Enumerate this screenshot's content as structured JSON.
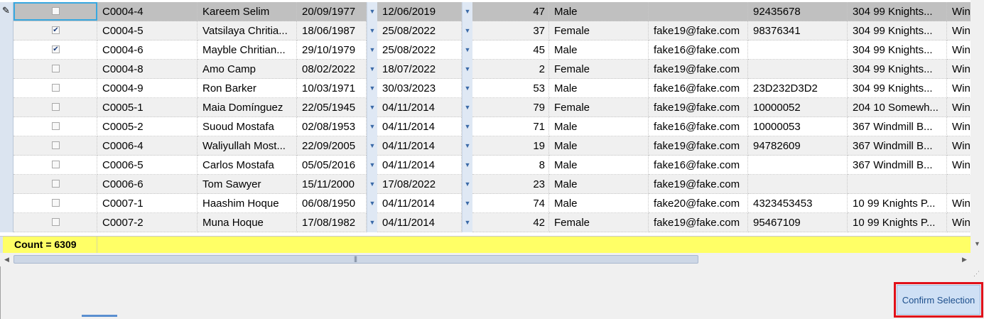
{
  "grid": {
    "rows": [
      {
        "selected": false,
        "code": "C0004-4",
        "name": "Kareem Selim",
        "dob": "20/09/1977",
        "date2": "12/06/2019",
        "age": "47",
        "gender": "Male",
        "email": "",
        "phone": "92435678",
        "address": "304 99 Knights...",
        "city": "Win"
      },
      {
        "selected": true,
        "code": "C0004-5",
        "name": "Vatsilaya Chritia...",
        "dob": "18/06/1987",
        "date2": "25/08/2022",
        "age": "37",
        "gender": "Female",
        "email": "fake19@fake.com",
        "phone": "98376341",
        "address": "304 99 Knights...",
        "city": "Win"
      },
      {
        "selected": true,
        "code": "C0004-6",
        "name": "Mayble Chritian...",
        "dob": "29/10/1979",
        "date2": "25/08/2022",
        "age": "45",
        "gender": "Male",
        "email": "fake16@fake.com",
        "phone": "",
        "address": "304 99 Knights...",
        "city": "Win"
      },
      {
        "selected": false,
        "code": "C0004-8",
        "name": "Amo Camp",
        "dob": "08/02/2022",
        "date2": "18/07/2022",
        "age": "2",
        "gender": "Female",
        "email": "fake19@fake.com",
        "phone": "",
        "address": "304 99 Knights...",
        "city": "Win"
      },
      {
        "selected": false,
        "code": "C0004-9",
        "name": "Ron Barker",
        "dob": "10/03/1971",
        "date2": "30/03/2023",
        "age": "53",
        "gender": "Male",
        "email": "fake16@fake.com",
        "phone": "23D232D3D2",
        "address": "304 99 Knights...",
        "city": "Win"
      },
      {
        "selected": false,
        "code": "C0005-1",
        "name": "Maia Domínguez",
        "dob": "22/05/1945",
        "date2": "04/11/2014",
        "age": "79",
        "gender": "Female",
        "email": "fake19@fake.com",
        "phone": "10000052",
        "address": "204 10 Somewh...",
        "city": "Win"
      },
      {
        "selected": false,
        "code": "C0005-2",
        "name": "Suoud Mostafa",
        "dob": "02/08/1953",
        "date2": "04/11/2014",
        "age": "71",
        "gender": "Male",
        "email": "fake16@fake.com",
        "phone": "10000053",
        "address": " 367 Windmill B...",
        "city": "Win"
      },
      {
        "selected": false,
        "code": "C0006-4",
        "name": "Waliyullah Most...",
        "dob": "22/09/2005",
        "date2": "04/11/2014",
        "age": "19",
        "gender": "Male",
        "email": "fake19@fake.com",
        "phone": "94782609",
        "address": " 367 Windmill B...",
        "city": "Win"
      },
      {
        "selected": false,
        "code": "C0006-5",
        "name": "Carlos Mostafa",
        "dob": "05/05/2016",
        "date2": "04/11/2014",
        "age": "8",
        "gender": "Male",
        "email": "fake16@fake.com",
        "phone": "",
        "address": " 367 Windmill B...",
        "city": "Win"
      },
      {
        "selected": false,
        "code": "C0006-6",
        "name": "Tom Sawyer",
        "dob": "15/11/2000",
        "date2": "17/08/2022",
        "age": "23",
        "gender": "Male",
        "email": "fake19@fake.com",
        "phone": "",
        "address": "",
        "city": ""
      },
      {
        "selected": false,
        "code": "C0007-1",
        "name": "Haashim Hoque",
        "dob": "06/08/1950",
        "date2": "04/11/2014",
        "age": "74",
        "gender": "Male",
        "email": "fake20@fake.com",
        "phone": "4323453453",
        "address": "10 99 Knights P...",
        "city": "Win"
      },
      {
        "selected": false,
        "code": "C0007-2",
        "name": "Muna Hoque",
        "dob": "17/08/1982",
        "date2": "04/11/2014",
        "age": "42",
        "gender": "Female",
        "email": "fake19@fake.com",
        "phone": "95467109",
        "address": "10 99 Knights P...",
        "city": "Win"
      }
    ],
    "footer": {
      "count_text": "Count = 6309"
    }
  },
  "icons": {
    "row_indicator": "pencil-edit-icon",
    "dropdown": "chevron-down-icon",
    "scroll_left": "arrow-left-icon",
    "scroll_right": "arrow-right-icon",
    "scroll_down": "arrow-down-icon"
  },
  "actions": {
    "confirm_label": "Confirm Selection"
  },
  "colors": {
    "footer_background": "#ffff66",
    "highlight_border": "#e0101a",
    "focus_border": "#38a8e0",
    "button_background": "#cfe0f5"
  }
}
